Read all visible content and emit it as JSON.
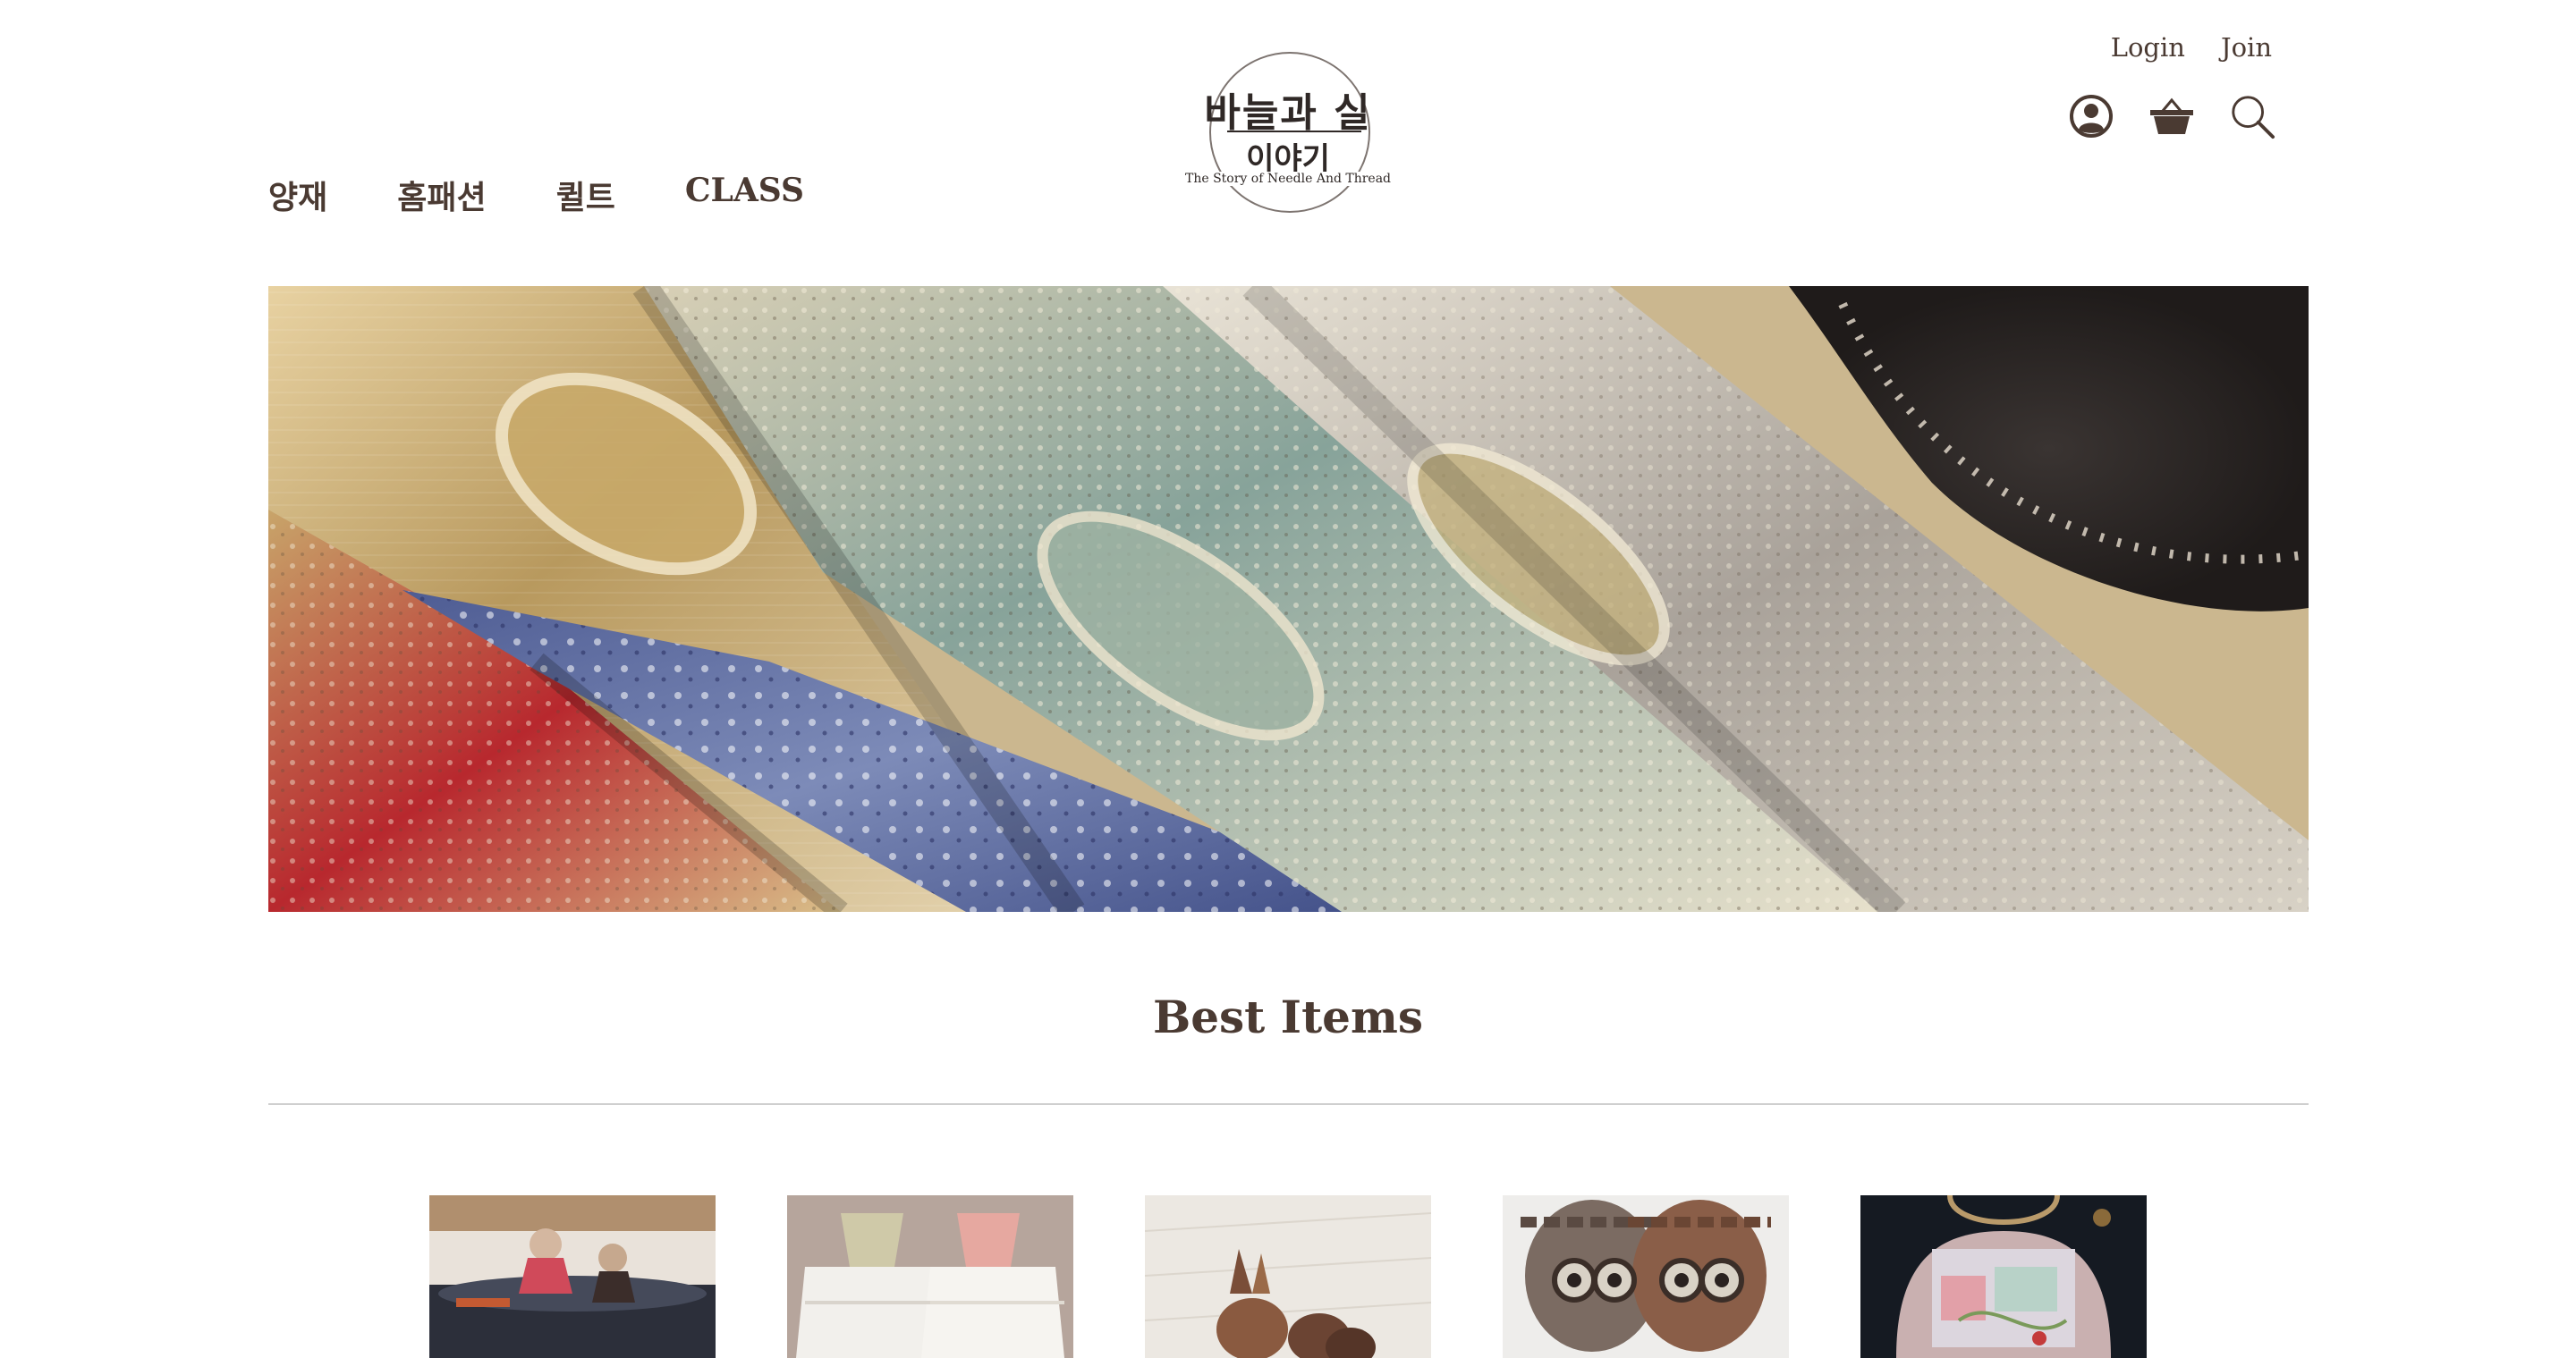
{
  "header": {
    "login_label": "Login",
    "join_label": "Join",
    "icons": [
      "user-icon",
      "basket-icon",
      "search-icon"
    ]
  },
  "logo": {
    "main": "바늘과 실",
    "sub": "이야기",
    "tagline": "The Story of Needle And Thread"
  },
  "nav": {
    "items": [
      {
        "label": "양재"
      },
      {
        "label": "홈패션"
      },
      {
        "label": "퀼트"
      },
      {
        "label": "CLASS"
      }
    ]
  },
  "banner": {
    "description_icon": "fabric-banner-image"
  },
  "best": {
    "title": "Best Items",
    "products": [
      {
        "thumb": "doll-pencil-case-image"
      },
      {
        "thumb": "doll-dresses-image"
      },
      {
        "thumb": "fabric-animals-image"
      },
      {
        "thumb": "owl-coasters-image"
      },
      {
        "thumb": "quilt-bag-image"
      }
    ]
  },
  "colors": {
    "text": "#4a3a32",
    "divider": "#cfcfcf",
    "background": "#ffffff"
  }
}
